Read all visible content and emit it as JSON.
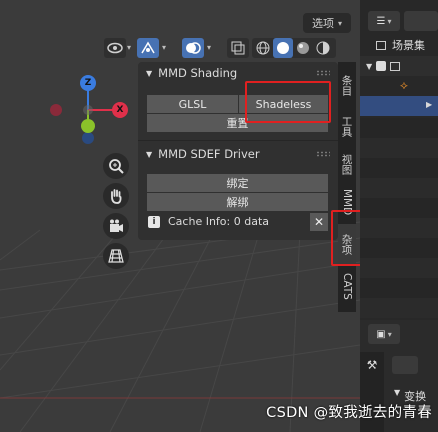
{
  "header": {
    "options_label": "选项",
    "icons": [
      "eye-icon",
      "gizmo-icon",
      "overlay-icon",
      "xray-icon",
      "wireframe-icon",
      "solid-icon",
      "material-preview-icon",
      "rendered-icon"
    ]
  },
  "navigation": {
    "axis_x": "X",
    "axis_y": "Y",
    "axis_z": "Z",
    "tools": [
      "zoom-icon",
      "hand-icon",
      "camera-icon",
      "grid-icon"
    ]
  },
  "mmd_shading": {
    "title": "MMD Shading",
    "glsl_label": "GLSL",
    "shadeless_label": "Shadeless",
    "reset_label": "重置"
  },
  "mmd_sdef": {
    "title": "MMD SDEF Driver",
    "bind_label": "绑定",
    "unbind_label": "解绑",
    "cache_info": "Cache Info: 0 data"
  },
  "side_tabs": [
    "条目",
    "工具",
    "视图",
    "MMD",
    "杂项",
    "CATS"
  ],
  "outliner": {
    "scene_collection": "场景集"
  },
  "properties": {
    "section_label": "变换"
  },
  "watermark": "CSDN @致我逝去的青春",
  "colors": {
    "highlight": "#e02020",
    "accent": "#4772b3",
    "axis_x": "#e0304a",
    "axis_y": "#8bc22a",
    "axis_z": "#3a7ce0"
  }
}
